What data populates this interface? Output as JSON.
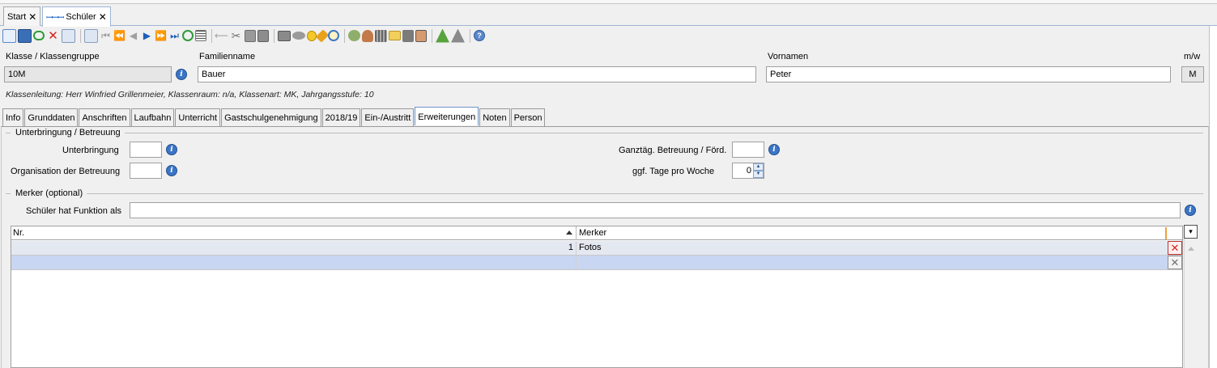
{
  "doc_tabs": [
    {
      "label": "Start",
      "active": false
    },
    {
      "label": "Schüler",
      "active": true
    }
  ],
  "toolbar": {
    "icons": [
      "new-record-icon",
      "save-icon",
      "undo-icon",
      "delete-icon",
      "cancel-edit-icon",
      "copy-record-icon",
      "first-record-icon",
      "prev-page-icon",
      "prev-record-icon",
      "next-record-icon",
      "next-page-icon",
      "last-record-icon",
      "refresh-icon",
      "list-view-icon",
      "back-icon",
      "cut-icon",
      "copy-icon",
      "paste-icon",
      "print-icon",
      "report-icon",
      "tips-icon",
      "clean-icon",
      "alarm-icon",
      "group-edit-icon",
      "users-icon",
      "grid-icon",
      "export-icon",
      "book-icon",
      "contact-card-icon",
      "tree-icon",
      "wizard-icon",
      "help-icon"
    ]
  },
  "header": {
    "klasse_label": "Klasse / Klassengruppe",
    "klasse_value": "10M",
    "familienname_label": "Familienname",
    "familienname_value": "Bauer",
    "vornamen_label": "Vornamen",
    "vornamen_value": "Peter",
    "mw_label": "m/w",
    "mw_value": "M",
    "info_line": "Klassenleitung: Herr Winfried Grillenmeier, Klassenraum: n/a, Klassenart: MK, Jahrgangsstufe: 10"
  },
  "content_tabs": [
    {
      "label": "Info",
      "active": false
    },
    {
      "label": "Grunddaten",
      "active": false
    },
    {
      "label": "Anschriften",
      "active": false
    },
    {
      "label": "Laufbahn",
      "active": false
    },
    {
      "label": "Unterricht",
      "active": false
    },
    {
      "label": "Gastschulgenehmigung",
      "active": false
    },
    {
      "label": "2018/19",
      "active": false
    },
    {
      "label": "Ein-/Austritt",
      "active": false
    },
    {
      "label": "Erweiterungen",
      "active": true
    },
    {
      "label": "Noten",
      "active": false
    },
    {
      "label": "Person",
      "active": false
    }
  ],
  "unterbringung": {
    "section_title": "Unterbringung / Betreuung",
    "unterbringung_label": "Unterbringung",
    "unterbringung_value": "",
    "organisation_label": "Organisation der Betreuung",
    "organisation_value": "",
    "ganztag_label": "Ganztäg. Betreuung / Förd.",
    "ganztag_value": "",
    "tage_label": "ggf. Tage pro Woche",
    "tage_value": "0"
  },
  "merker": {
    "section_title": "Merker (optional)",
    "funktion_label": "Schüler hat Funktion als",
    "funktion_value": "",
    "columns": {
      "nr": "Nr.",
      "merker": "Merker"
    },
    "rows": [
      {
        "nr": "1",
        "merker": "Fotos"
      },
      {
        "nr": "",
        "merker": ""
      }
    ]
  }
}
